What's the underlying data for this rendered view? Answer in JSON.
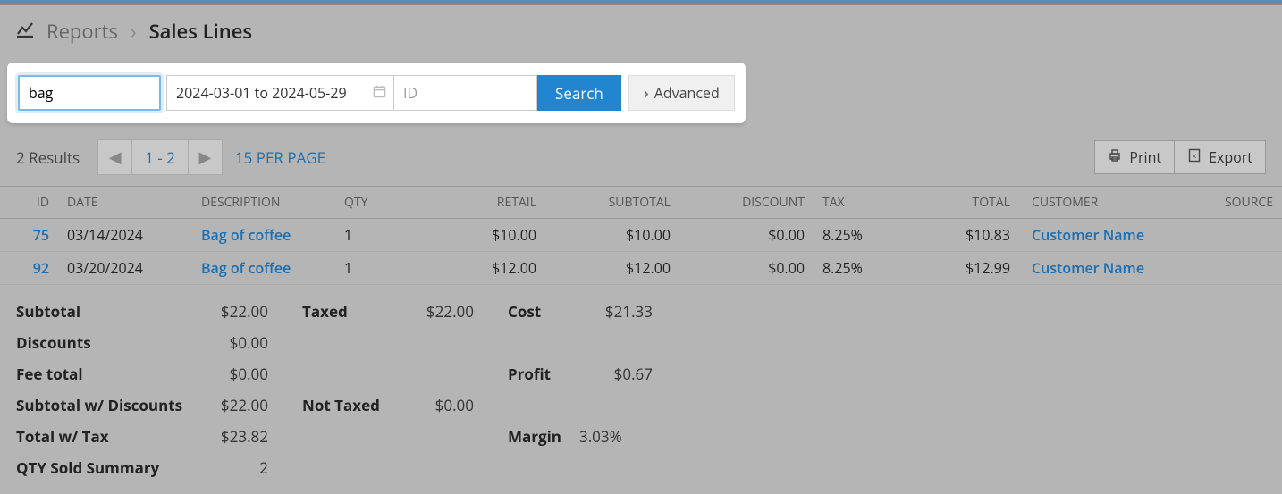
{
  "breadcrumb": {
    "root": "Reports",
    "current": "Sales Lines"
  },
  "search": {
    "term": "bag",
    "date_range": "2024-03-01 to 2024-05-29",
    "id_placeholder": "ID",
    "button": "Search",
    "advanced": "Advanced"
  },
  "toolbar": {
    "results": "2 Results",
    "range": "1 - 2",
    "per_page": "15 PER PAGE",
    "print": "Print",
    "export": "Export"
  },
  "table": {
    "headers": {
      "id": "ID",
      "date": "DATE",
      "description": "DESCRIPTION",
      "qty": "QTY",
      "retail": "RETAIL",
      "subtotal": "SUBTOTAL",
      "discount": "DISCOUNT",
      "tax": "TAX",
      "total": "TOTAL",
      "customer": "CUSTOMER",
      "source": "SOURCE"
    },
    "rows": [
      {
        "id": "75",
        "date": "03/14/2024",
        "description": "Bag of coffee",
        "qty": "1",
        "retail": "$10.00",
        "subtotal": "$10.00",
        "discount": "$0.00",
        "tax": "8.25%",
        "total": "$10.83",
        "customer": "Customer Name",
        "source": ""
      },
      {
        "id": "92",
        "date": "03/20/2024",
        "description": "Bag of coffee",
        "qty": "1",
        "retail": "$12.00",
        "subtotal": "$12.00",
        "discount": "$0.00",
        "tax": "8.25%",
        "total": "$12.99",
        "customer": "Customer Name",
        "source": ""
      }
    ]
  },
  "summary": {
    "col1": [
      {
        "label": "Subtotal",
        "val": "$22.00"
      },
      {
        "label": "Discounts",
        "val": "$0.00"
      },
      {
        "label": "Fee total",
        "val": "$0.00"
      },
      {
        "label": "Subtotal w/ Discounts",
        "val": "$22.00"
      },
      {
        "label": "Total w/ Tax",
        "val": "$23.82"
      },
      {
        "label": "QTY Sold Summary",
        "val": "2"
      }
    ],
    "col2": [
      {
        "label": "Taxed",
        "val": "$22.00"
      },
      {
        "label": "Not Taxed",
        "val": "$0.00"
      }
    ],
    "col3": [
      {
        "label": "Cost",
        "val": "$21.33"
      },
      {
        "label": "Profit",
        "val": "$0.67"
      },
      {
        "label": "Margin",
        "val": "3.03%"
      }
    ]
  }
}
